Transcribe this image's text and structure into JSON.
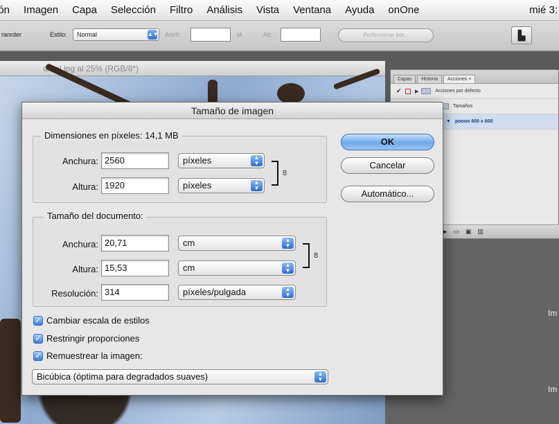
{
  "menubar": {
    "items": [
      "ión",
      "Imagen",
      "Capa",
      "Selección",
      "Filtro",
      "Análisis",
      "Vista",
      "Ventana",
      "Ayuda",
      "onOne"
    ],
    "clock": "mié 3:"
  },
  "optionsbar": {
    "left_label": "ranrder",
    "style_label": "Estilo:",
    "style_value": "Normal",
    "width_label": "Anch:",
    "height_label": "Alt:",
    "refine_button": "Perfeccionar bor..."
  },
  "document": {
    "title": "arbol.jpg al 25% (RGB/8*)"
  },
  "panel": {
    "tabs": [
      "Capas",
      "Historia",
      "Acciones ×"
    ],
    "rows": [
      {
        "label": "Acciones por defecto",
        "selected": false
      },
      {
        "label": "Tamaños",
        "selected": false
      },
      {
        "label": "poooo 800 x 600",
        "selected": true
      }
    ]
  },
  "right_labels": [
    "Im",
    "Im"
  ],
  "dialog": {
    "title": "Tamaño de imagen",
    "pixel_dims": {
      "label": "Dimensiones en píxeles: 14,1 MB",
      "width_label": "Anchura:",
      "width_value": "2560",
      "width_unit": "píxeles",
      "height_label": "Altura:",
      "height_value": "1920",
      "height_unit": "píxeles"
    },
    "doc_size": {
      "label": "Tamaño del documento:",
      "width_label": "Anchura:",
      "width_value": "20,71",
      "width_unit": "cm",
      "height_label": "Altura:",
      "height_value": "15,53",
      "height_unit": "cm",
      "res_label": "Resolución:",
      "res_value": "314",
      "res_unit": "píxeles/pulgada"
    },
    "checkboxes": [
      {
        "label": "Cambiar escala de estilos",
        "checked": true
      },
      {
        "label": "Restringir proporciones",
        "checked": true
      },
      {
        "label": "Remuestrear la imagen:",
        "checked": true
      }
    ],
    "resample_method": "Bicúbica (óptima para degradados suaves)",
    "buttons": {
      "ok": "OK",
      "cancel": "Cancelar",
      "auto": "Automático..."
    }
  }
}
